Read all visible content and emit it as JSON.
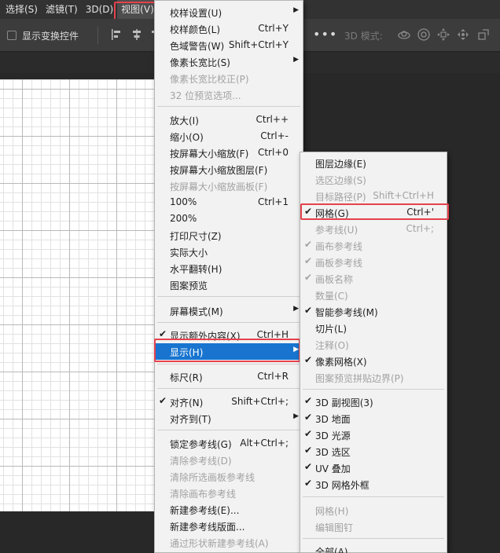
{
  "menubar": {
    "items": [
      {
        "label": "选择(S)"
      },
      {
        "label": "滤镜(T)"
      },
      {
        "label": "3D(D)"
      },
      {
        "label": "视图(V)"
      }
    ]
  },
  "options": {
    "show_transform_label": "显示变换控件",
    "more": "•••",
    "mode3d_label": "3D 模式:"
  },
  "view_menu": {
    "items": [
      {
        "label": "校样设置(U)"
      },
      {
        "label": "校样颜色(L)",
        "shortcut": "Ctrl+Y"
      },
      {
        "label": "色域警告(W)",
        "shortcut": "Shift+Ctrl+Y"
      },
      {
        "label": "像素长宽比(S)"
      },
      {
        "label": "像素长宽比校正(P)"
      },
      {
        "label": "32 位预览选项..."
      },
      {
        "label": "放大(I)",
        "shortcut": "Ctrl++"
      },
      {
        "label": "缩小(O)",
        "shortcut": "Ctrl+-"
      },
      {
        "label": "按屏幕大小缩放(F)",
        "shortcut": "Ctrl+0"
      },
      {
        "label": "按屏幕大小缩放图层(F)"
      },
      {
        "label": "按屏幕大小缩放画板(F)"
      },
      {
        "label": "100%",
        "shortcut": "Ctrl+1"
      },
      {
        "label": "200%"
      },
      {
        "label": "打印尺寸(Z)"
      },
      {
        "label": "实际大小"
      },
      {
        "label": "水平翻转(H)"
      },
      {
        "label": "图案预览"
      },
      {
        "label": "屏幕模式(M)"
      },
      {
        "label": "显示额外内容(X)",
        "shortcut": "Ctrl+H"
      },
      {
        "label": "显示(H)"
      },
      {
        "label": "标尺(R)",
        "shortcut": "Ctrl+R"
      },
      {
        "label": "对齐(N)",
        "shortcut": "Shift+Ctrl+;"
      },
      {
        "label": "对齐到(T)"
      },
      {
        "label": "锁定参考线(G)",
        "shortcut": "Alt+Ctrl+;"
      },
      {
        "label": "清除参考线(D)"
      },
      {
        "label": "清除所选画板参考线"
      },
      {
        "label": "清除画布参考线"
      },
      {
        "label": "新建参考线(E)..."
      },
      {
        "label": "新建参考线版面..."
      },
      {
        "label": "通过形状新建参考线(A)"
      }
    ]
  },
  "show_menu": {
    "items": [
      {
        "label": "图层边缘(E)"
      },
      {
        "label": "选区边缘(S)"
      },
      {
        "label": "目标路径(P)",
        "shortcut": "Shift+Ctrl+H"
      },
      {
        "label": "网格(G)",
        "shortcut": "Ctrl+'"
      },
      {
        "label": "参考线(U)",
        "shortcut": "Ctrl+;"
      },
      {
        "label": "画布参考线"
      },
      {
        "label": "画板参考线"
      },
      {
        "label": "画板名称"
      },
      {
        "label": "数量(C)"
      },
      {
        "label": "智能参考线(M)"
      },
      {
        "label": "切片(L)"
      },
      {
        "label": "注释(O)"
      },
      {
        "label": "像素网格(X)"
      },
      {
        "label": "图案预览拼贴边界(P)"
      },
      {
        "label": "3D 副视图(3)"
      },
      {
        "label": "3D 地面"
      },
      {
        "label": "3D 光源"
      },
      {
        "label": "3D 选区"
      },
      {
        "label": "UV 叠加"
      },
      {
        "label": "3D 网格外框"
      },
      {
        "label": "网格(H)"
      },
      {
        "label": "编辑图钉"
      },
      {
        "label": "全部(A)"
      }
    ]
  },
  "glyphs": {
    "check": "✔",
    "arrow": "▶"
  },
  "colors": {
    "highlight": "#1874cf",
    "annotation": "#e5424d",
    "menu_bg": "#f2f2f2"
  }
}
